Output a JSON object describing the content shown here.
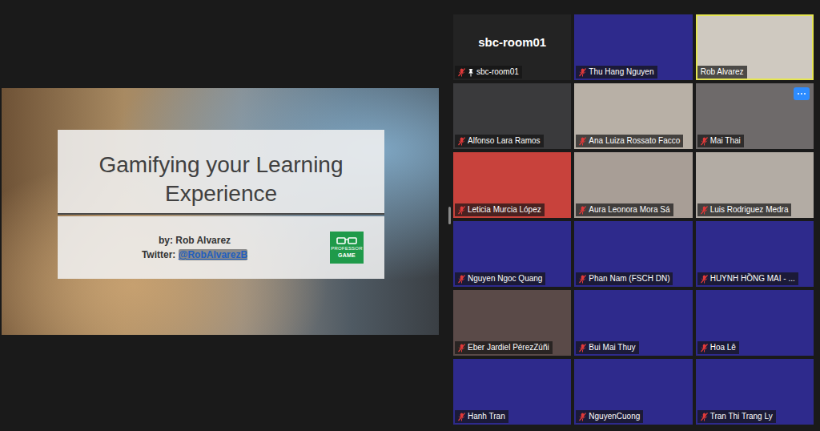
{
  "share": {
    "slide": {
      "title": "Gamifying your Learning Experience",
      "byline": "by: Rob Alvarez",
      "twitter_label": "Twitter: ",
      "twitter_handle": "@RobAlvarezB",
      "logo_top": "PROFESSOR",
      "logo_bottom": "GAME"
    }
  },
  "participants": [
    {
      "name": "sbc-room01",
      "kind": "avatar",
      "muted": true,
      "pinned": true,
      "speaking": false,
      "hovered": false,
      "color": "#232323"
    },
    {
      "name": "Thu Hang Nguyen",
      "kind": "video",
      "muted": true,
      "pinned": false,
      "speaking": false,
      "hovered": false,
      "color": "#2e2a8c"
    },
    {
      "name": "Rob Alvarez",
      "kind": "video",
      "muted": false,
      "pinned": false,
      "speaking": true,
      "hovered": false,
      "color": "#cfc9c0"
    },
    {
      "name": "Alfonso Lara Ramos",
      "kind": "video",
      "muted": true,
      "pinned": false,
      "speaking": false,
      "hovered": false,
      "color": "#3a3a3c"
    },
    {
      "name": "Ana Luiza Rossato Facco",
      "kind": "video",
      "muted": true,
      "pinned": false,
      "speaking": false,
      "hovered": false,
      "color": "#b8b0a6"
    },
    {
      "name": "Mai Thai",
      "kind": "video",
      "muted": true,
      "pinned": false,
      "speaking": false,
      "hovered": true,
      "color": "#6e6a6a"
    },
    {
      "name": "Leticia Murcia López",
      "kind": "video",
      "muted": true,
      "pinned": false,
      "speaking": false,
      "hovered": false,
      "color": "#c8423c"
    },
    {
      "name": "Aura Leonora Mora Sá",
      "kind": "video",
      "muted": true,
      "pinned": false,
      "speaking": false,
      "hovered": false,
      "color": "#a89e96"
    },
    {
      "name": "Luis Rodriguez Medra",
      "kind": "video",
      "muted": true,
      "pinned": false,
      "speaking": false,
      "hovered": false,
      "color": "#b3aca4"
    },
    {
      "name": "Nguyen Ngoc Quang",
      "kind": "video",
      "muted": true,
      "pinned": false,
      "speaking": false,
      "hovered": false,
      "color": "#2e2a8c"
    },
    {
      "name": "Phan Nam (FSCH DN)",
      "kind": "video",
      "muted": true,
      "pinned": false,
      "speaking": false,
      "hovered": false,
      "color": "#2e2a8c"
    },
    {
      "name": "HUYNH HỒNG MAI - ...",
      "kind": "video",
      "muted": true,
      "pinned": false,
      "speaking": false,
      "hovered": false,
      "color": "#2e2a8c"
    },
    {
      "name": "Eber Jardiel PérezZúñi",
      "kind": "video",
      "muted": true,
      "pinned": false,
      "speaking": false,
      "hovered": false,
      "color": "#5a4a48"
    },
    {
      "name": "Bui Mai Thuy",
      "kind": "video",
      "muted": true,
      "pinned": false,
      "speaking": false,
      "hovered": false,
      "color": "#2e2a8c"
    },
    {
      "name": "Hoa Lê",
      "kind": "video",
      "muted": true,
      "pinned": false,
      "speaking": false,
      "hovered": false,
      "color": "#2e2a8c"
    },
    {
      "name": "Hanh Tran",
      "kind": "video",
      "muted": true,
      "pinned": false,
      "speaking": false,
      "hovered": false,
      "color": "#2e2a8c"
    },
    {
      "name": "NguyenCuong",
      "kind": "video",
      "muted": true,
      "pinned": false,
      "speaking": false,
      "hovered": false,
      "color": "#2e2a8c"
    },
    {
      "name": "Tran Thi Trang Ly",
      "kind": "video",
      "muted": true,
      "pinned": false,
      "speaking": false,
      "hovered": false,
      "color": "#2e2a8c"
    }
  ]
}
